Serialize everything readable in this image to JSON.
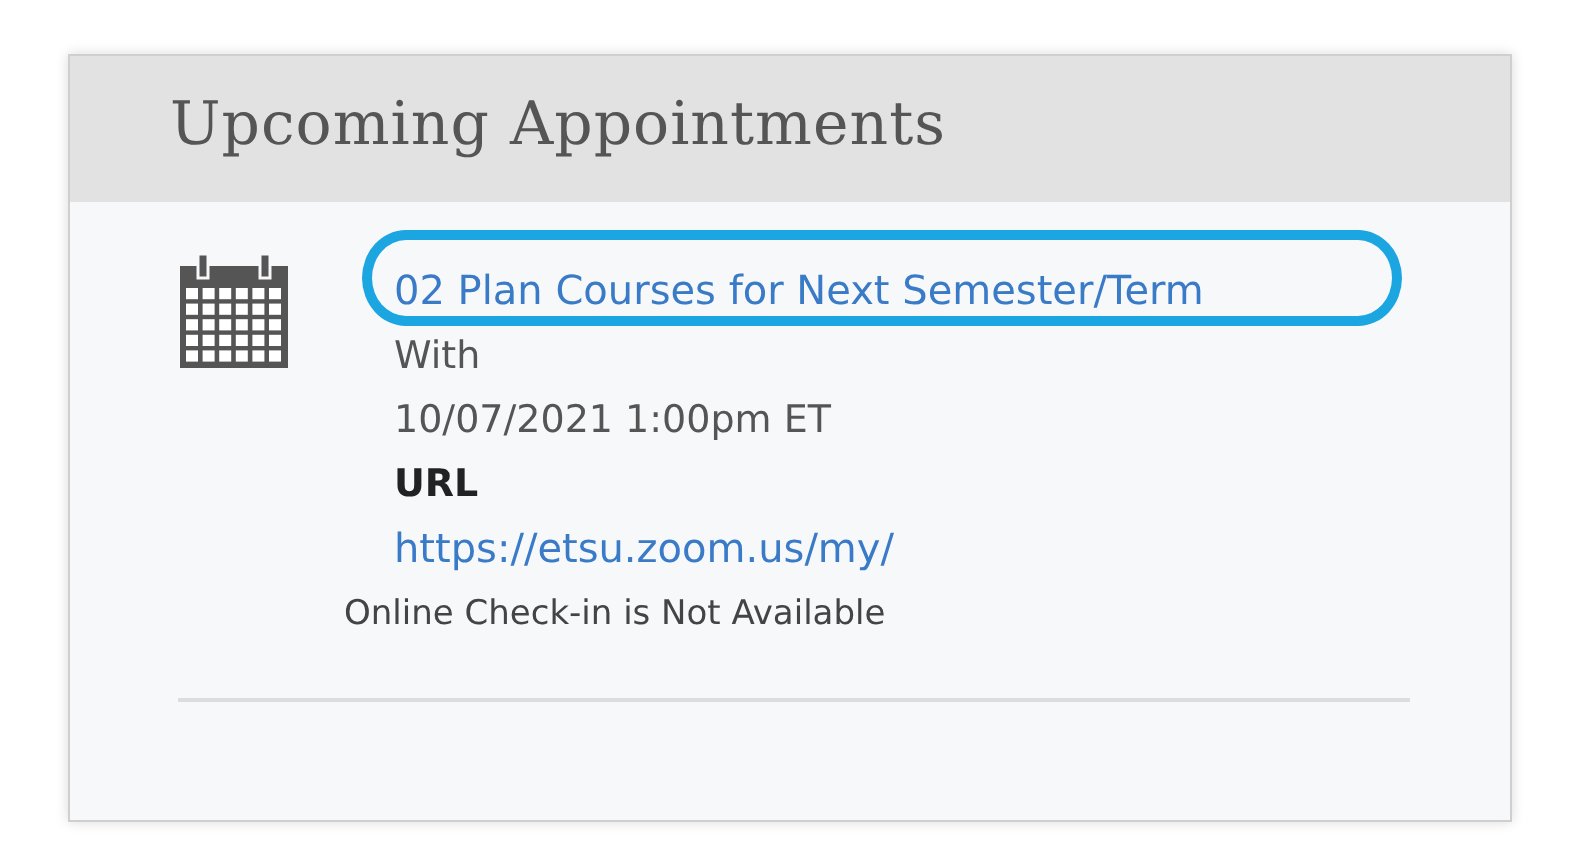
{
  "panel": {
    "title": "Upcoming Appointments"
  },
  "appointments": [
    {
      "title": "02 Plan Courses for Next Semester/Term",
      "with": "With",
      "datetime": "10/07/2021 1:00pm ET",
      "url_label": "URL",
      "url": "https://etsu.zoom.us/my/",
      "check_in": "Online Check-in is Not Available",
      "highlighted": true
    }
  ]
}
